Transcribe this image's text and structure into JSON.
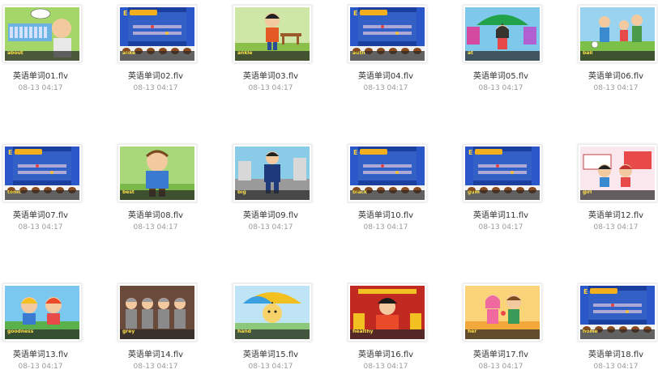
{
  "files": [
    {
      "name": "英语单词01.flv",
      "date": "08-13 04:17",
      "word": "about",
      "scene": "classroom"
    },
    {
      "name": "英语单词02.flv",
      "date": "08-13 04:17",
      "word": "alike",
      "scene": "stage"
    },
    {
      "name": "英语单词03.flv",
      "date": "08-13 04:17",
      "word": "ankle",
      "scene": "boy"
    },
    {
      "name": "英语单词04.flv",
      "date": "08-13 04:17",
      "word": "auth",
      "scene": "stage"
    },
    {
      "name": "英语单词05.flv",
      "date": "08-13 04:17",
      "word": "at",
      "scene": "umbrella-girl"
    },
    {
      "name": "英语单词06.flv",
      "date": "08-13 04:17",
      "word": "ball",
      "scene": "family"
    },
    {
      "name": "英语单词07.flv",
      "date": "08-13 04:17",
      "word": "tonic",
      "scene": "stage"
    },
    {
      "name": "英语单词08.flv",
      "date": "08-13 04:17",
      "word": "best",
      "scene": "man"
    },
    {
      "name": "英语单词09.flv",
      "date": "08-13 04:17",
      "word": "big",
      "scene": "businessman"
    },
    {
      "name": "英语单词10.flv",
      "date": "08-13 04:17",
      "word": "black",
      "scene": "stage"
    },
    {
      "name": "英语单词11.flv",
      "date": "08-13 04:17",
      "word": "gum",
      "scene": "stage"
    },
    {
      "name": "英语单词12.flv",
      "date": "08-13 04:17",
      "word": "girl",
      "scene": "kids"
    },
    {
      "name": "英语单词13.flv",
      "date": "08-13 04:17",
      "word": "goodness",
      "scene": "workers"
    },
    {
      "name": "英语单词14.flv",
      "date": "08-13 04:17",
      "word": "grey",
      "scene": "miners"
    },
    {
      "name": "英语单词15.flv",
      "date": "08-13 04:17",
      "word": "hand",
      "scene": "umbrella-face"
    },
    {
      "name": "英语单词16.flv",
      "date": "08-13 04:17",
      "word": "healthy",
      "scene": "theater"
    },
    {
      "name": "英语单词17.flv",
      "date": "08-13 04:17",
      "word": "her",
      "scene": "couple"
    },
    {
      "name": "英语单词18.flv",
      "date": "08-13 04:17",
      "word": "home",
      "scene": "stage"
    }
  ]
}
